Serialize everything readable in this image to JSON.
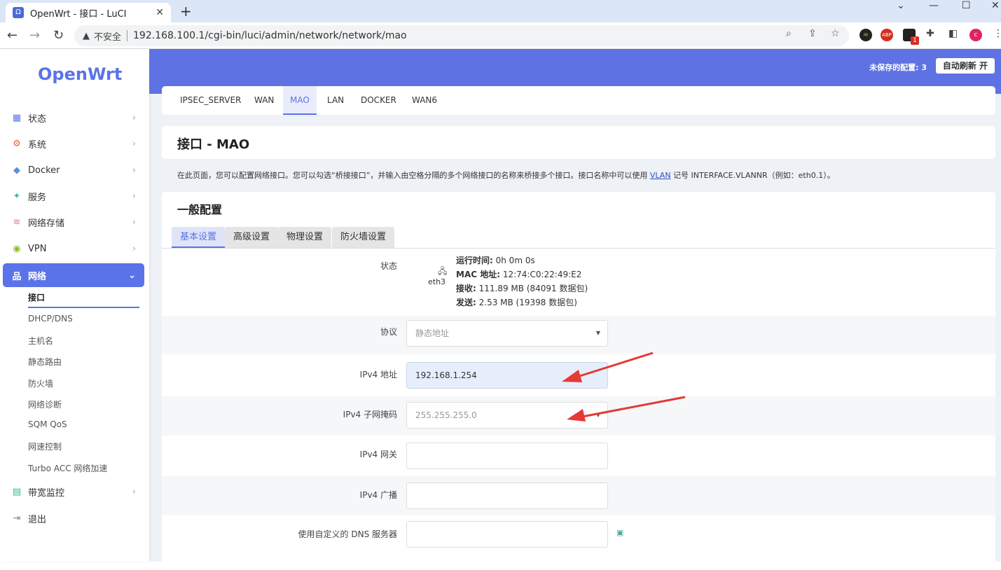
{
  "browser": {
    "tab_title": "OpenWrt - 接口 - LuCI",
    "tab_close": "✕",
    "new_tab": "+",
    "insecure_label": "不安全",
    "url": "192.168.100.1/cgi-bin/luci/admin/network/network/mao",
    "ext_badge": "1",
    "ext_abp": "ABP",
    "profile_initial": "c"
  },
  "sidebar": {
    "logo": "OpenWrt",
    "items": [
      {
        "label": "状态",
        "icon": "▦",
        "color": "#5b73e8"
      },
      {
        "label": "系统",
        "icon": "⚙",
        "color": "#e8613c"
      },
      {
        "label": "Docker",
        "icon": "◆",
        "color": "#5b8fd8"
      },
      {
        "label": "服务",
        "icon": "✦",
        "color": "#3cbfb0"
      },
      {
        "label": "网络存储",
        "icon": "≋",
        "color": "#e87a7a"
      },
      {
        "label": "VPN",
        "icon": "◉",
        "color": "#8bbd2c"
      },
      {
        "label": "网络",
        "icon": "品",
        "color": "#ffffff"
      },
      {
        "label": "带宽监控",
        "icon": "▤",
        "color": "#2ec08a"
      },
      {
        "label": "退出",
        "icon": "⇥",
        "color": "#888888"
      }
    ],
    "sub_items": [
      "接口",
      "DHCP/DNS",
      "主机名",
      "静态路由",
      "防火墙",
      "网络诊断",
      "SQM QoS",
      "网速控制",
      "Turbo ACC 网络加速"
    ]
  },
  "header": {
    "unsaved": "未保存的配置: 3",
    "auto_refresh": "自动刷新 开"
  },
  "iface_tabs": [
    "IPSEC_SERVER",
    "WAN",
    "MAO",
    "LAN",
    "DOCKER",
    "WAN6"
  ],
  "page_title": "接口 - MAO",
  "description": {
    "before": "在此页面，您可以配置网络接口。您可以勾选“桥接接口”，并输入由空格分隔的多个网络接口的名称来桥接多个接口。接口名称中可以使用 ",
    "link": "VLAN",
    "after": " 记号 INTERFACE.VLANNR（例如：eth0.1）。"
  },
  "section_title": "一般配置",
  "sub_tabs": [
    "基本设置",
    "高级设置",
    "物理设置",
    "防火墙设置"
  ],
  "status": {
    "label": "状态",
    "device": "eth3",
    "uptime_label": "运行时间:",
    "uptime_value": " 0h 0m 0s",
    "mac_label": "MAC 地址:",
    "mac_value": " 12:74:C0:22:49:E2",
    "rx_label": "接收:",
    "rx_value": " 111.89 MB (84091 数据包)",
    "tx_label": "发送:",
    "tx_value": " 2.53 MB (19398 数据包)"
  },
  "fields": {
    "protocol_label": "协议",
    "protocol_value": "静态地址",
    "ipv4_addr_label": "IPv4 地址",
    "ipv4_addr_value": "192.168.1.254",
    "ipv4_mask_label": "IPv4 子网掩码",
    "ipv4_mask_value": "255.255.255.0",
    "ipv4_gw_label": "IPv4 网关",
    "ipv4_gw_value": "",
    "ipv4_bcast_label": "IPv4 广播",
    "ipv4_bcast_value": "",
    "dns_label": "使用自定义的 DNS 服务器",
    "dns_value": ""
  },
  "colors": {
    "accent": "#5e72e4",
    "annotation_arrow": "#e53935"
  }
}
